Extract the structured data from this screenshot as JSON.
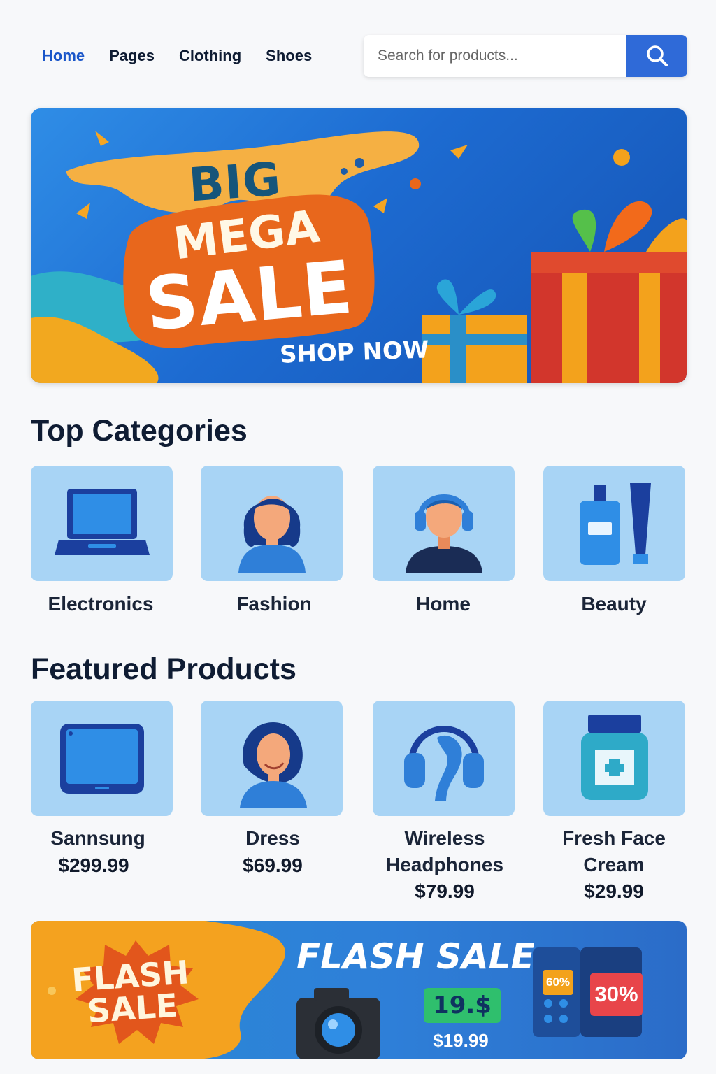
{
  "nav": {
    "items": [
      {
        "label": "Home",
        "active": true
      },
      {
        "label": "Pages",
        "active": false
      },
      {
        "label": "Clothing",
        "active": false
      },
      {
        "label": "Shoes",
        "active": false
      }
    ]
  },
  "search": {
    "placeholder": "Search for products...",
    "button_icon": "search-icon"
  },
  "hero": {
    "word_big": "BIG",
    "word_mega": "MEGA",
    "word_sale": "SALE",
    "cta": "SHOP NOW"
  },
  "categories": {
    "title": "Top Categories",
    "items": [
      {
        "label": "Electronics",
        "icon": "laptop-icon"
      },
      {
        "label": "Fashion",
        "icon": "woman-icon"
      },
      {
        "label": "Home",
        "icon": "headset-person-icon"
      },
      {
        "label": "Beauty",
        "icon": "cosmetics-icon"
      }
    ]
  },
  "featured": {
    "title": "Featured Products",
    "items": [
      {
        "name": "Sannsung",
        "price": "$299.99",
        "icon": "tablet-icon"
      },
      {
        "name": "Dress",
        "price": "$69.99",
        "icon": "woman-icon"
      },
      {
        "name": "Wireless Headphones",
        "price": "$79.99",
        "icon": "headphones-icon"
      },
      {
        "name": "Fresh Face Cream",
        "price": "$29.99",
        "icon": "cream-jar-icon"
      }
    ]
  },
  "flash": {
    "burst_text": "FLASH SALE",
    "title": "FLASH SALE",
    "tag": "19.$",
    "price": "$19.99",
    "badge_small": "60%",
    "badge_large": "30%"
  },
  "colors": {
    "accent": "#2f6ad8",
    "nav_active": "#1a56c9",
    "tile_bg": "#a8d4f5",
    "page_bg": "#f7f8fa",
    "hero_orange": "#e8671c",
    "hero_yellow": "#f5a623"
  }
}
